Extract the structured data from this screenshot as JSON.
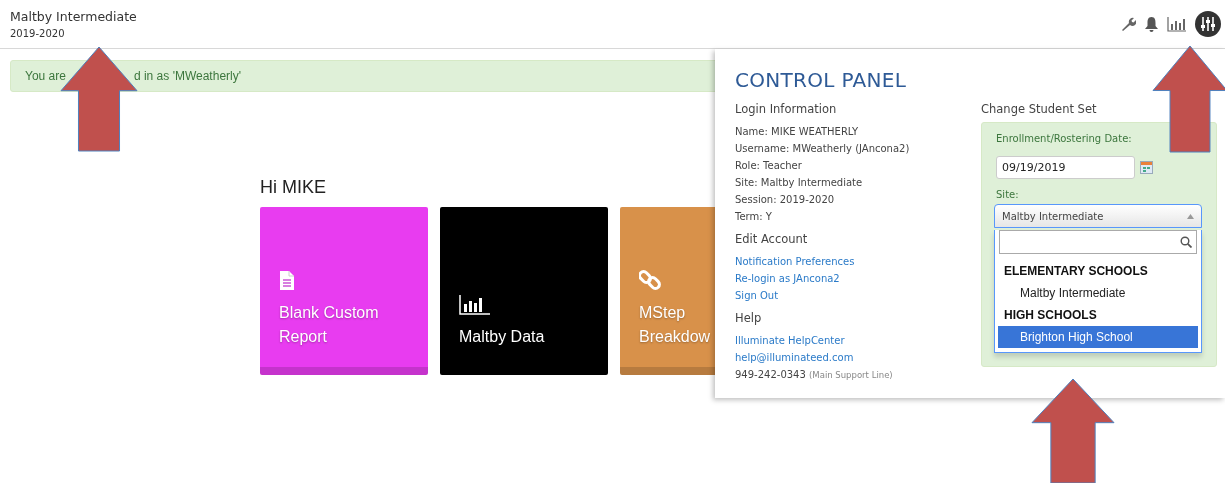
{
  "header": {
    "school": "Maltby Intermediate",
    "session": "2019-2020",
    "toolbar": [
      {
        "kind": "wrench",
        "selected": false
      },
      {
        "kind": "bell",
        "selected": false
      },
      {
        "kind": "chart",
        "selected": false
      },
      {
        "kind": "sliders",
        "selected": true
      }
    ]
  },
  "alert": {
    "text_parts": [
      "You are",
      "d in as 'MWeatherly'"
    ]
  },
  "greeting": "Hi MIKE",
  "tiles": [
    {
      "label": "Blank Custom Report",
      "color": "#e83cf0",
      "kind": "document"
    },
    {
      "label": "Maltby Data",
      "color": "#000000",
      "kind": "chart"
    },
    {
      "label": "MStep Breakdow",
      "color": "#d8914a",
      "kind": "link"
    }
  ],
  "control_panel": {
    "title": "CONTROL PANEL",
    "sections": [
      {
        "heading": "Login Information",
        "lines": [
          {
            "kind": "text",
            "text": "Name: MIKE WEATHERLY"
          },
          {
            "kind": "text",
            "text": "Username: MWeatherly (JAncona2)"
          },
          {
            "kind": "text",
            "text": "Role: Teacher"
          },
          {
            "kind": "text",
            "text": "Site: Maltby Intermediate"
          },
          {
            "kind": "text",
            "text": "Session: 2019-2020"
          },
          {
            "kind": "text",
            "text": "Term: Y"
          }
        ]
      },
      {
        "heading": "Edit Account",
        "lines": [
          {
            "kind": "link",
            "text": "Notification Preferences"
          },
          {
            "kind": "link",
            "text": "Re-login as JAncona2"
          },
          {
            "kind": "link",
            "text": "Sign Out"
          }
        ]
      },
      {
        "heading": "Help",
        "lines": [
          {
            "kind": "link",
            "text": "Illuminate HelpCenter"
          },
          {
            "kind": "link",
            "text": "help@illuminateed.com"
          },
          {
            "kind": "phone",
            "text": "949-242-0343",
            "note": "(Main Support Line)"
          }
        ]
      }
    ],
    "student_set": {
      "heading": "Change Student Set",
      "date_label": "Enrollment/Rostering Date:",
      "date_value": "09/19/2019",
      "site_label": "Site:",
      "site_value": "Maltby Intermediate",
      "expanded": true,
      "groups": [
        {
          "label": "ELEMENTARY SCHOOLS",
          "options": [
            {
              "label": "Maltby Intermediate",
              "selected": false
            }
          ]
        },
        {
          "label": "HIGH SCHOOLS",
          "options": [
            {
              "label": "Brighton High School",
              "selected": true
            }
          ]
        }
      ]
    }
  },
  "annotations": [
    {
      "kind": "arrow"
    },
    {
      "kind": "arrow"
    },
    {
      "kind": "arrow"
    }
  ]
}
